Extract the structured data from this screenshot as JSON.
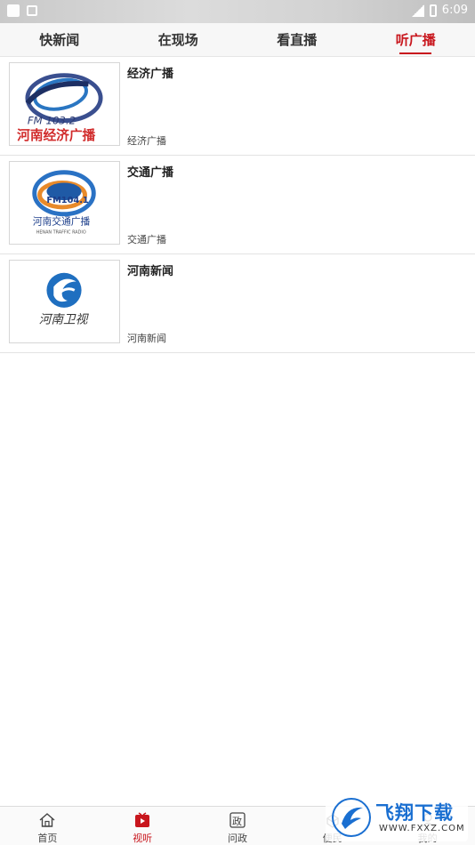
{
  "status_bar": {
    "time": "6:09"
  },
  "tabs": [
    {
      "label": "快新闻",
      "active": false
    },
    {
      "label": "在现场",
      "active": false
    },
    {
      "label": "看直播",
      "active": false
    },
    {
      "label": "听广播",
      "active": true
    }
  ],
  "items": [
    {
      "title": "经济广播",
      "subtitle": "经济广播",
      "thumb_icon": "henan-economy-radio-logo",
      "logo_text": "FM 103.2",
      "logo_caption": "河南经济广播"
    },
    {
      "title": "交通广播",
      "subtitle": "交通广播",
      "thumb_icon": "henan-traffic-radio-logo",
      "logo_text": "FM104.1",
      "logo_caption": "河南交通广播",
      "logo_caption_en": "HENAN TRAFFIC RADIO"
    },
    {
      "title": "河南新闻",
      "subtitle": "河南新闻",
      "thumb_icon": "henan-tv-logo",
      "logo_caption": "河南卫视"
    }
  ],
  "bottom_nav": [
    {
      "label": "首页",
      "icon": "home-icon",
      "active": false
    },
    {
      "label": "视听",
      "icon": "play-icon",
      "active": true
    },
    {
      "label": "问政",
      "icon": "zheng-icon",
      "icon_char": "政",
      "active": false
    },
    {
      "label": "便民",
      "icon": "service-icon",
      "active": false
    },
    {
      "label": "我的",
      "icon": "user-icon",
      "active": false
    }
  ],
  "watermark": {
    "title": "飞翔下载",
    "url": "WWW.FXXZ.COM"
  },
  "colors": {
    "accent": "#c8161d",
    "watermark_blue": "#1a6fd1"
  }
}
